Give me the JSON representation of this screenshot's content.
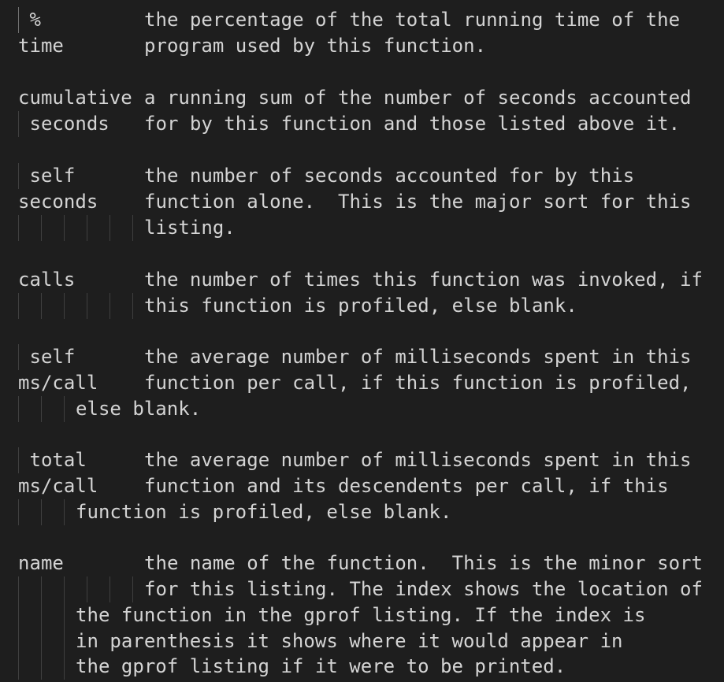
{
  "editor": {
    "lines": [
      {
        "col1": " %",
        "col2": "the percentage of the total running time of the"
      },
      {
        "col1": "time",
        "col2": "program used by this function."
      },
      {
        "col1": "",
        "col2": ""
      },
      {
        "col1": "cumulative",
        "col2": "a running sum of the number of seconds accounted"
      },
      {
        "col1": " seconds",
        "col2": "for by this function and those listed above it."
      },
      {
        "col1": "",
        "col2": ""
      },
      {
        "col1": " self",
        "col2": "the number of seconds accounted for by this"
      },
      {
        "col1": "seconds",
        "col2": "function alone.  This is the major sort for this"
      },
      {
        "col1": "",
        "col2": "listing."
      },
      {
        "col1": "",
        "col2": ""
      },
      {
        "col1": "calls",
        "col2": "the number of times this function was invoked, if"
      },
      {
        "col1": "",
        "col2": "this function is profiled, else blank."
      },
      {
        "col1": "",
        "col2": ""
      },
      {
        "col1": " self",
        "col2": "the average number of milliseconds spent in this"
      },
      {
        "col1": "ms/call",
        "col2": "function per call, if this function is profiled,"
      },
      {
        "col1": "",
        "col2": "else blank."
      },
      {
        "col1": "",
        "col2": ""
      },
      {
        "col1": " total",
        "col2": "the average number of milliseconds spent in this"
      },
      {
        "col1": "ms/call",
        "col2": "function and its descendents per call, if this"
      },
      {
        "col1": "",
        "col2": "function is profiled, else blank."
      },
      {
        "col1": "",
        "col2": ""
      },
      {
        "col1": "name",
        "col2": "the name of the function.  This is the minor sort"
      },
      {
        "col1": "",
        "col2": "for this listing. The index shows the location of"
      },
      {
        "col1": "",
        "col2": "the function in the gprof listing. If the index is"
      },
      {
        "col1": "",
        "col2": "in parenthesis it shows where it would appear in"
      },
      {
        "col1": "",
        "col2": "the gprof listing if it were to be printed."
      }
    ]
  }
}
